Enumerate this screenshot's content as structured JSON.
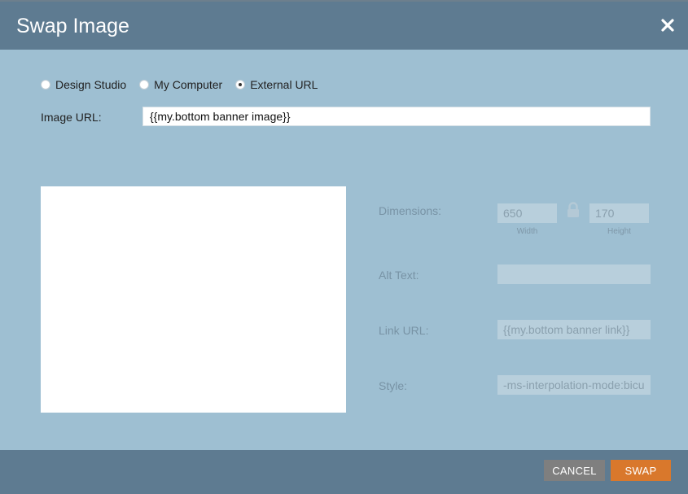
{
  "dialog": {
    "title": "Swap Image",
    "close_icon": "close-x-icon"
  },
  "source_options": [
    {
      "label": "Design Studio",
      "checked": false
    },
    {
      "label": "My Computer",
      "checked": false
    },
    {
      "label": "External URL",
      "checked": true
    }
  ],
  "image_url": {
    "label": "Image URL:",
    "value": "{{my.bottom banner image}}"
  },
  "properties": {
    "dimensions_label": "Dimensions:",
    "width_value": "650",
    "width_caption": "Width",
    "height_value": "170",
    "height_caption": "Height",
    "lock_icon": "lock-icon",
    "alt_text_label": "Alt Text:",
    "alt_text_value": "",
    "link_url_label": "Link URL:",
    "link_url_value": "{{my.bottom banner link}}",
    "style_label": "Style:",
    "style_value": "-ms-interpolation-mode:bicubic;"
  },
  "footer": {
    "cancel_label": "CANCEL",
    "swap_label": "SWAP"
  },
  "colors": {
    "header_bg": "#5e7b91",
    "body_bg": "#9ebfd2",
    "swap_button": "#d9782c",
    "cancel_button": "#7f7f7f"
  }
}
